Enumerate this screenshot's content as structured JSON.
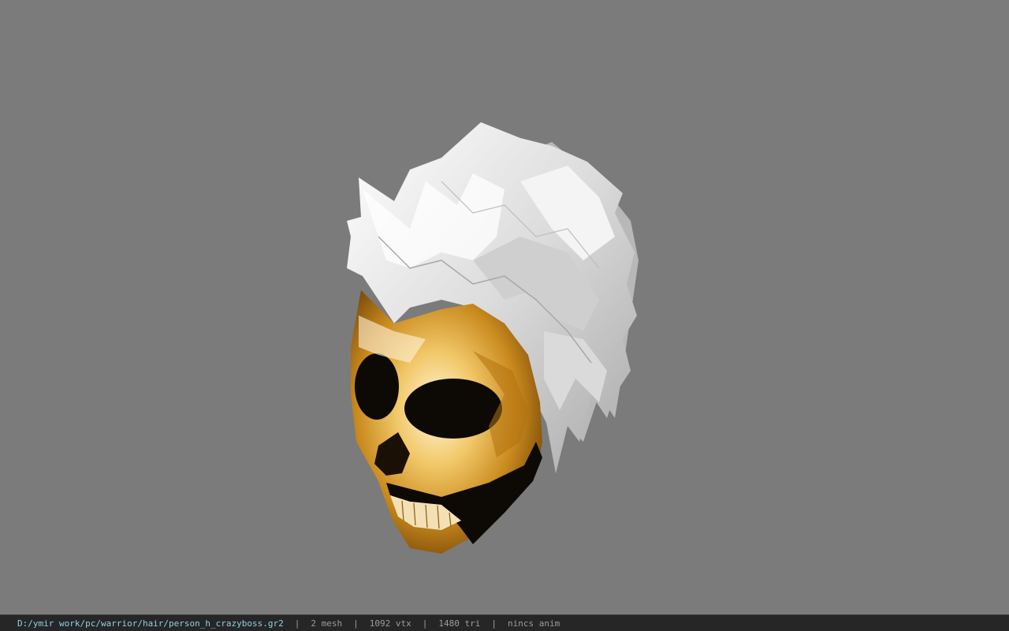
{
  "viewer": {
    "background_color": "#7b7b7b",
    "model": {
      "description_icon": "model-preview-icon",
      "hair_color": "#e8e8e8",
      "skull_color": "#d99a2a"
    }
  },
  "statusbar": {
    "file_path": "D:/ymir work/pc/warrior/hair/person_h_crazyboss.gr2",
    "separator": "|",
    "mesh": "2 mesh",
    "vtx": "1092 vtx",
    "tri": "1480 tri",
    "anim": "nincs anim",
    "path_color": "#8fd0e8",
    "text_color": "#9c9c9c",
    "bg_color": "#262626"
  }
}
